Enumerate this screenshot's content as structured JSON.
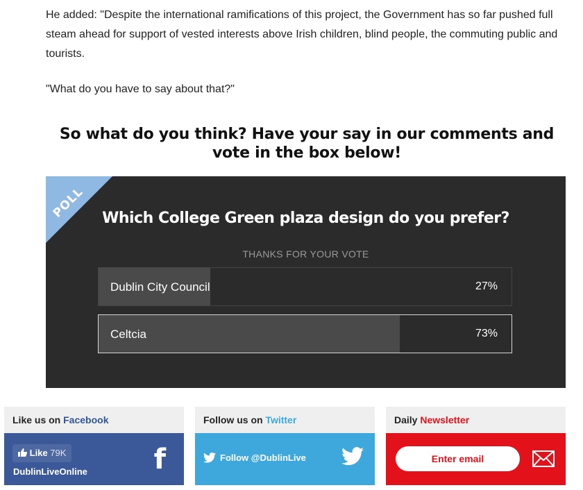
{
  "article": {
    "paragraph1": "He added: \"Despite the international ramifications of this project, the Government has so far pushed full steam ahead for support of vested interests above Irish children, blind people, the commuting public and tourists.",
    "paragraph2": "\"What do you have to say about that?\""
  },
  "cta": "So what do you think? Have your say in our comments and vote in the box below!",
  "poll": {
    "ribbon": "POLL",
    "question": "Which College Green plaza design do you prefer?",
    "status": "THANKS FOR YOUR VOTE",
    "options": [
      {
        "label": "Dublin City Council",
        "percent_text": "27%",
        "percent": 27,
        "selected": false
      },
      {
        "label": "Celtcia",
        "percent_text": "73%",
        "percent": 73,
        "selected": true
      }
    ]
  },
  "social": {
    "facebook": {
      "heading_prefix": "Like us on",
      "heading_accent": "Facebook",
      "like_label": "Like",
      "like_count": "79K",
      "page_name": "DublinLiveOnline",
      "glyph": "f"
    },
    "twitter": {
      "heading_prefix": "Follow us on",
      "heading_accent": "Twitter",
      "follow_label": "Follow @DublinLive"
    },
    "newsletter": {
      "heading_prefix": "Daily",
      "heading_accent": "Newsletter",
      "input_placeholder": "Enter email"
    }
  },
  "colors": {
    "poll_bg": "#2b2b2b",
    "poll_ribbon": "#8fb8e2",
    "facebook": "#3b5998",
    "twitter": "#3ea8dc",
    "newsletter": "#e3121a"
  }
}
